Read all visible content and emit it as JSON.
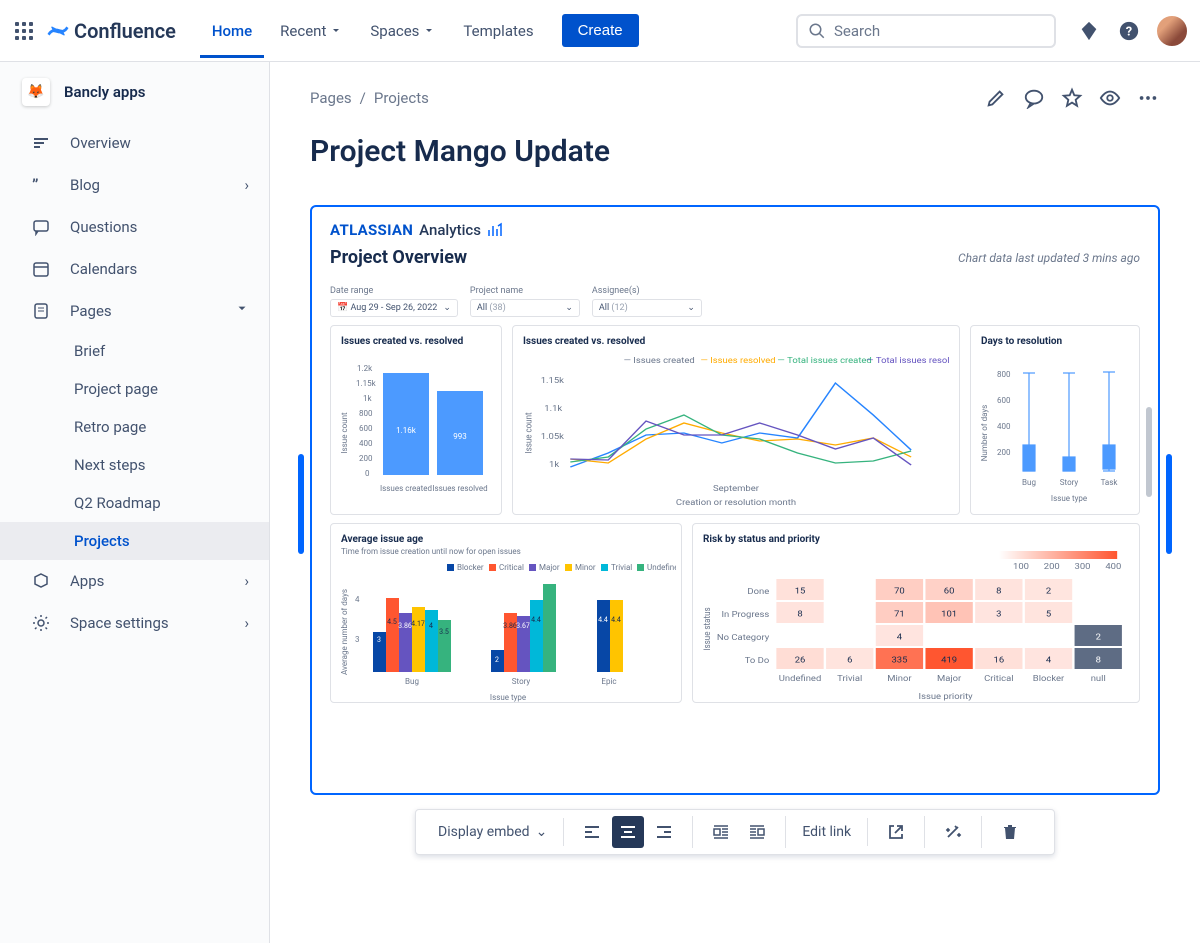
{
  "topnav": {
    "product": "Confluence",
    "home": "Home",
    "recent": "Recent",
    "spaces": "Spaces",
    "templates": "Templates",
    "create": "Create",
    "search_placeholder": "Search"
  },
  "space": {
    "name": "Bancly apps"
  },
  "sidebar": {
    "overview": "Overview",
    "blog": "Blog",
    "questions": "Questions",
    "calendars": "Calendars",
    "pages": "Pages",
    "brief": "Brief",
    "project_page": "Project page",
    "retro_page": "Retro page",
    "next_steps": "Next steps",
    "q2_roadmap": "Q2 Roadmap",
    "projects": "Projects",
    "apps": "Apps",
    "space_settings": "Space settings"
  },
  "breadcrumb": {
    "root": "Pages",
    "current": "Projects"
  },
  "page": {
    "title": "Project Mango Update"
  },
  "embed": {
    "brand_a": "ATLASSIAN",
    "brand_b": "Analytics",
    "title": "Project Overview",
    "updated": "Chart data last updated 3 mins ago",
    "filters": {
      "date_label": "Date range",
      "date_value": "Aug 29 - Sep 26, 2022",
      "project_label": "Project name",
      "project_value": "All",
      "project_count": "(38)",
      "assignee_label": "Assignee(s)",
      "assignee_value": "All",
      "assignee_count": "(12)"
    },
    "c1": {
      "title": "Issues created vs. resolved",
      "legend": [
        "Issues created",
        "Issues resolved"
      ],
      "xlabel": "",
      "ylabel": "Issue count"
    },
    "c2": {
      "title": "Issues created vs. resolved",
      "xlabel": "Creation or resolution month",
      "month": "September",
      "ylabel": "Issue count",
      "legend": [
        "Issues created",
        "Issues resolved",
        "Total issues created",
        "Total issues resolved"
      ]
    },
    "c3": {
      "title": "Days to resolution",
      "ylabel": "Number of days",
      "xlabel": "Issue type"
    },
    "c4": {
      "title": "Average issue age",
      "sub": "Time from issue creation until now for open issues",
      "ylabel": "Average number of days",
      "xlabel": "Issue type",
      "legend": [
        "Blocker",
        "Critical",
        "Major",
        "Minor",
        "Trivial",
        "Undefined"
      ]
    },
    "c5": {
      "title": "Risk by status and priority",
      "xlabel": "Issue priority",
      "ylabel": "Issue status"
    }
  },
  "toolbar": {
    "display": "Display embed",
    "edit_link": "Edit link"
  },
  "chart_data": [
    {
      "id": "issues_created_resolved_bar",
      "type": "bar",
      "title": "Issues created vs. resolved",
      "ylabel": "Issue count",
      "ylim": [
        0,
        1200
      ],
      "yticks": [
        0,
        200,
        400,
        600,
        800,
        "1k",
        "1.15k",
        "1.2k"
      ],
      "categories": [
        "Issues created",
        "Issues resolved"
      ],
      "values": [
        1160,
        993
      ],
      "value_labels": [
        "1.16k",
        "993"
      ]
    },
    {
      "id": "issues_created_resolved_line",
      "type": "line",
      "title": "Issues created vs. resolved",
      "ylabel": "Issue count",
      "xlabel": "Creation or resolution month",
      "x_center_label": "September",
      "yticks": [
        "1k",
        "1.05k",
        "1.1k",
        "1.15k"
      ],
      "ylim": [
        1000,
        1160
      ],
      "series": [
        {
          "name": "Issues created",
          "color": "#2684FF",
          "values": [
            1000,
            1028,
            1062,
            1065,
            1045,
            1065,
            1055,
            1155,
            1080,
            1035
          ]
        },
        {
          "name": "Issues resolved",
          "color": "#FFAB00",
          "values": [
            1015,
            1005,
            1055,
            1080,
            1065,
            1048,
            1052,
            1040,
            1055,
            1020
          ]
        },
        {
          "name": "Total issues created",
          "color": "#36B37E",
          "values": [
            1008,
            1020,
            1072,
            1098,
            1060,
            1052,
            1025,
            1005,
            1012,
            1030
          ]
        },
        {
          "name": "Total issues resolved",
          "color": "#6554C0",
          "values": [
            1015,
            1012,
            1088,
            1060,
            1060,
            1080,
            1060,
            1035,
            1055,
            1008
          ]
        }
      ]
    },
    {
      "id": "days_to_resolution",
      "type": "box",
      "title": "Days to resolution",
      "ylabel": "Number of days",
      "xlabel": "Issue type",
      "ylim": [
        0,
        800
      ],
      "yticks": [
        200,
        400,
        600,
        800
      ],
      "categories": [
        "Bug",
        "Story",
        "Task"
      ],
      "boxes": [
        {
          "whisker_low": 0,
          "q1": 20,
          "median": 100,
          "q3": 220,
          "whisker_high": 750
        },
        {
          "whisker_low": 0,
          "q1": 10,
          "median": 50,
          "q3": 120,
          "whisker_high": 750
        },
        {
          "whisker_low": 0,
          "q1": 40,
          "median": 120,
          "q3": 210,
          "whisker_high": 760
        }
      ]
    },
    {
      "id": "average_issue_age",
      "type": "bar",
      "title": "Average issue age",
      "subtitle": "Time from issue creation until now for open issues",
      "ylabel": "Average number of days",
      "xlabel": "Issue type",
      "ylim": [
        0,
        5.2
      ],
      "yticks": [
        3,
        4
      ],
      "categories": [
        "Bug",
        "Story",
        "Epic"
      ],
      "legend": [
        "Blocker",
        "Critical",
        "Major",
        "Minor",
        "Trivial",
        "Undefined"
      ],
      "colors": {
        "Blocker": "#0747A6",
        "Critical": "#FF5630",
        "Major": "#6554C0",
        "Minor": "#FFC400",
        "Trivial": "#00B8D9",
        "Undefined": "#36B37E"
      },
      "series": [
        {
          "name": "Blocker",
          "values": [
            3,
            2,
            4.4
          ]
        },
        {
          "name": "Critical",
          "values": [
            4.5,
            3.86,
            4.4
          ]
        },
        {
          "name": "Major",
          "values": [
            3.86,
            3.67,
            null
          ]
        },
        {
          "name": "Minor",
          "values": [
            4.17,
            null,
            null
          ]
        },
        {
          "name": "Trivial",
          "values": [
            4,
            4.4,
            null
          ]
        },
        {
          "name": "Undefined",
          "values": [
            3.5,
            5.1,
            null
          ]
        }
      ],
      "additional_label": "3.5"
    },
    {
      "id": "risk_by_status_priority",
      "type": "heatmap",
      "title": "Risk by status and priority",
      "xlabel": "Issue priority",
      "ylabel": "Issue status",
      "x_categories": [
        "Undefined",
        "Trivial",
        "Minor",
        "Major",
        "Critical",
        "Blocker",
        "null"
      ],
      "y_categories": [
        "Done",
        "In Progress",
        "No Category",
        "To Do"
      ],
      "scale_ticks": [
        100,
        200,
        300,
        400
      ],
      "values": [
        [
          15,
          null,
          70,
          60,
          8,
          2,
          null
        ],
        [
          8,
          null,
          71,
          101,
          3,
          5,
          null
        ],
        [
          null,
          null,
          4,
          null,
          null,
          null,
          2
        ],
        [
          26,
          6,
          335,
          419,
          16,
          4,
          8
        ]
      ]
    }
  ]
}
